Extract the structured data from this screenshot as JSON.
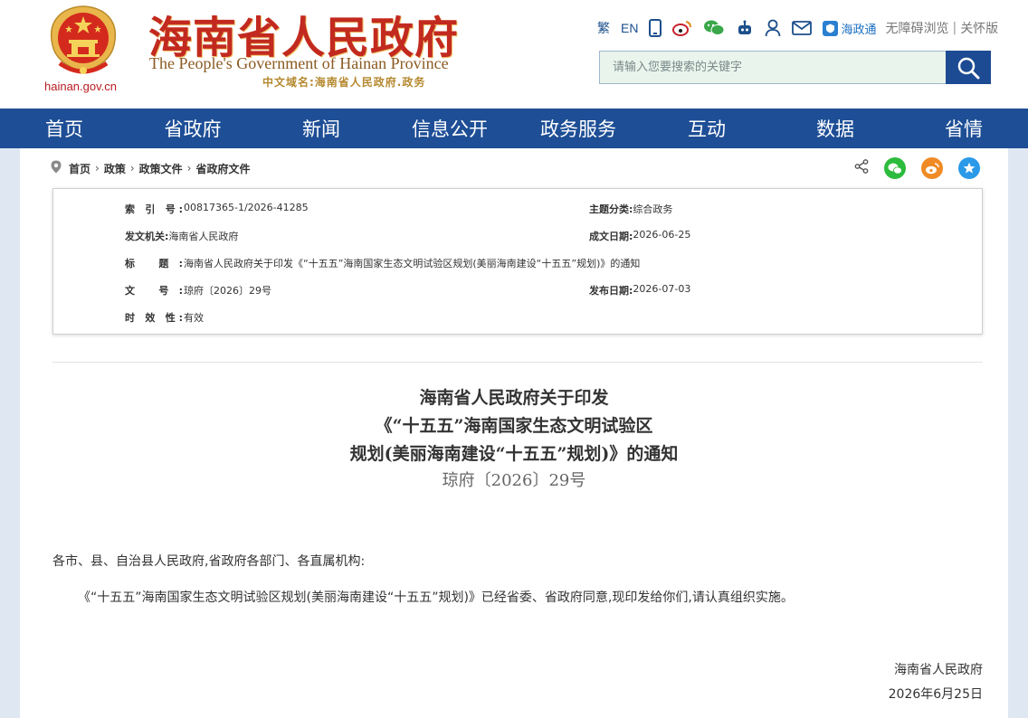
{
  "header": {
    "site_title": "海南省人民政府",
    "site_title_en": "The People's Government  of Hainan Province",
    "cn_domain": "中文域名:海南省人民政府.政务",
    "domain": "hainan.gov.cn",
    "toolbar": {
      "traditional": "繁",
      "english": "EN",
      "haizhengtong": "海政通",
      "accessibility": "无障碍浏览",
      "elder_mode": "关怀版",
      "separator": "|"
    },
    "search": {
      "placeholder": "请输入您要搜索的关键字"
    }
  },
  "colors": {
    "nav_bg": "#1e4f96",
    "brand_red": "#c32a1f",
    "search_btn": "#1d4b93"
  },
  "nav": [
    "首页",
    "省政府",
    "新闻",
    "信息公开",
    "政务服务",
    "互动",
    "数据",
    "省情"
  ],
  "breadcrumb": [
    "首页",
    "政策",
    "政策文件",
    "省政府文件"
  ],
  "meta": {
    "index_label": "索  引  号:",
    "index_value": "00817365-1/2026-41285",
    "category_label": "主题分类:",
    "category_value": "综合政务",
    "issuer_label": "发文机关:",
    "issuer_value": "海南省人民政府",
    "written_label": "成文日期:",
    "written_value": "2026-06-25",
    "title_label": "标    题:",
    "title_value": "海南省人民政府关于印发《“十五五”海南国家生态文明试验区规划(美丽海南建设“十五五”规划)》的通知",
    "docno_label": "文    号:",
    "docno_value": "琼府〔2026〕29号",
    "published_label": "发布日期:",
    "published_value": "2026-07-03",
    "validity_label": "时  效  性:",
    "validity_value": "有效"
  },
  "document": {
    "title_line1": "海南省人民政府关于印发",
    "title_line2": "《“十五五”海南国家生态文明试验区",
    "title_line3": "规划(美丽海南建设“十五五”规划)》的通知",
    "doc_number": "琼府〔2026〕29号",
    "addressee": "各市、县、自治县人民政府,省政府各部门、各直属机构:",
    "paragraph": "《“十五五”海南国家生态文明试验区规划(美丽海南建设“十五五”规划)》已经省委、省政府同意,现印发给你们,请认真组织实施。",
    "signature": "海南省人民政府",
    "date": "2026年6月25日"
  }
}
